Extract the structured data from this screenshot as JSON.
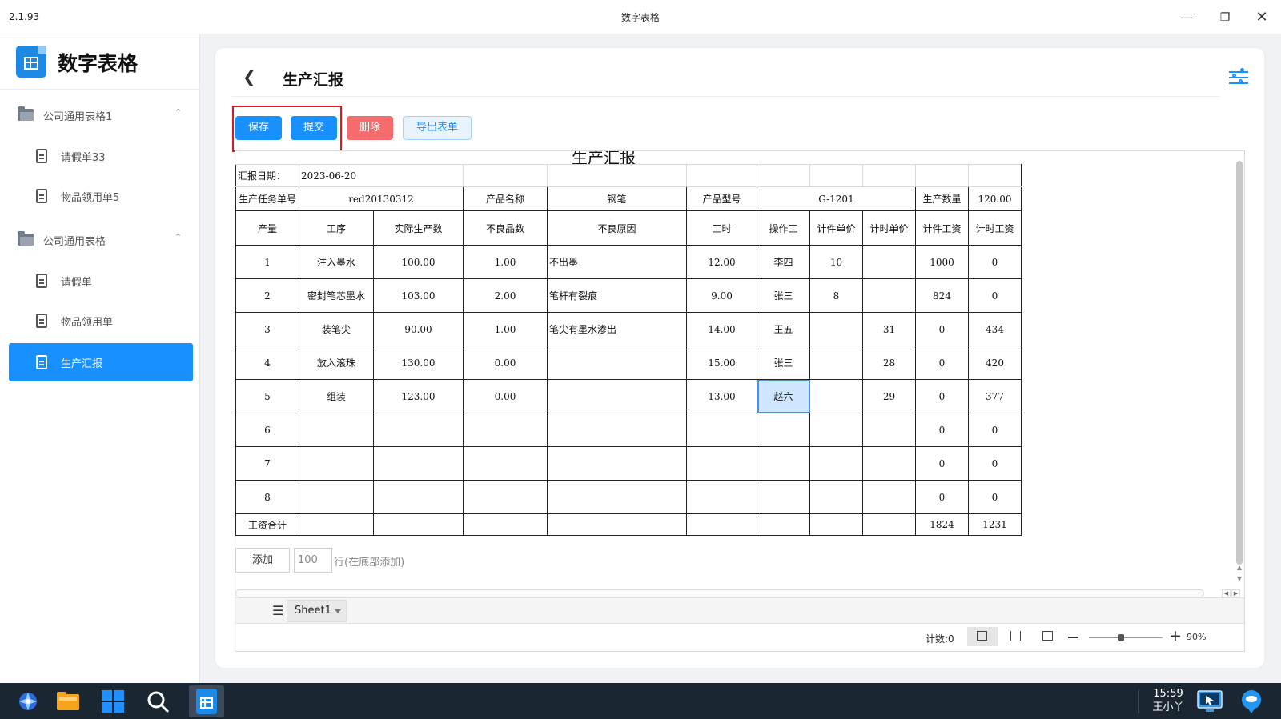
{
  "window": {
    "version": "2.1.93",
    "title": "数字表格",
    "minimize_icon": "minimize-icon",
    "restore_icon": "restore-icon",
    "close_icon": "close-icon"
  },
  "sidebar": {
    "brand": "数字表格",
    "groups": [
      {
        "label": "公司通用表格1",
        "items": [
          "请假单33",
          "物品领用单5"
        ]
      },
      {
        "label": "公司通用表格",
        "items": [
          "请假单",
          "物品领用单",
          "生产汇报"
        ]
      }
    ],
    "active_item": "生产汇报"
  },
  "header": {
    "title": "生产汇报",
    "back_icon": "chevron-left-icon",
    "settings_icon": "sliders-icon"
  },
  "toolbar": {
    "save": "保存",
    "submit": "提交",
    "delete": "删除",
    "export": "导出表单",
    "colors": {
      "primary": "#1890ff",
      "danger": "#f56c6c",
      "highlight": "#e0191f"
    }
  },
  "sheet": {
    "title": "生产汇报",
    "report_date_label": "汇报日期：",
    "report_date": "2023-06-20",
    "task_no_label": "生产任务单号",
    "task_no": "red20130312",
    "product_name_label": "产品名称",
    "product_name": "钢笔",
    "product_model_label": "产品型号",
    "product_model": "G-1201",
    "quantity_label": "生产数量",
    "quantity": "120.00",
    "columns": [
      "产量",
      "工序",
      "实际生产数",
      "不良品数",
      "不良原因",
      "工时",
      "操作工",
      "计件单价",
      "计时单价",
      "计件工资",
      "计时工资"
    ],
    "rows": [
      [
        "1",
        "注入墨水",
        "100.00",
        "1.00",
        "不出墨",
        "12.00",
        "李四",
        "10",
        "",
        "1000",
        "0"
      ],
      [
        "2",
        "密封笔芯墨水",
        "103.00",
        "2.00",
        "笔杆有裂痕",
        "9.00",
        "张三",
        "8",
        "",
        "824",
        "0"
      ],
      [
        "3",
        "装笔尖",
        "90.00",
        "1.00",
        "笔尖有墨水渗出",
        "14.00",
        "王五",
        "",
        "31",
        "0",
        "434"
      ],
      [
        "4",
        "放入滚珠",
        "130.00",
        "0.00",
        "",
        "15.00",
        "张三",
        "",
        "28",
        "0",
        "420"
      ],
      [
        "5",
        "组装",
        "123.00",
        "0.00",
        "",
        "13.00",
        "赵六",
        "",
        "29",
        "0",
        "377"
      ],
      [
        "6",
        "",
        "",
        "",
        "",
        "",
        "",
        "",
        "",
        "0",
        "0"
      ],
      [
        "7",
        "",
        "",
        "",
        "",
        "",
        "",
        "",
        "",
        "0",
        "0"
      ],
      [
        "8",
        "",
        "",
        "",
        "",
        "",
        "",
        "",
        "",
        "0",
        "0"
      ]
    ],
    "total_label": "工资合计",
    "total_piece": "1824",
    "total_time": "1231",
    "selected_cell": "赵六"
  },
  "add_rows": {
    "button": "添加",
    "count": "100",
    "suffix": "行(在底部添加)"
  },
  "tabs": {
    "sheet_name": "Sheet1",
    "menu_icon": "menu-icon"
  },
  "status": {
    "count": "计数:0",
    "zoom": "90%",
    "zoom_fraction": 0.9
  },
  "taskbar": {
    "time": "15:59",
    "user": "王小丫",
    "icons": [
      "launcher-icon",
      "file-manager-icon",
      "windows-icon",
      "search-icon",
      "spreadsheet-app-icon",
      "remote-desktop-icon",
      "chat-icon"
    ]
  }
}
